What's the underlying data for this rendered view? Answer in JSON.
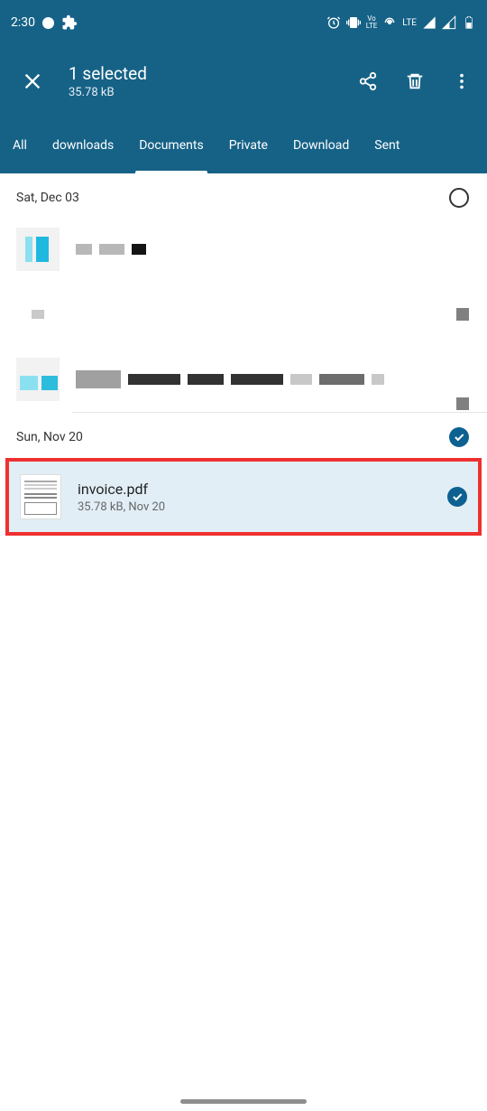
{
  "status": {
    "time": "2:30",
    "lte_label": "LTE",
    "volte_label": "Vo LTE"
  },
  "header": {
    "title": "1 selected",
    "subtitle": "35.78 kB"
  },
  "tabs": [
    {
      "label": "All",
      "active": false
    },
    {
      "label": "downloads",
      "active": false
    },
    {
      "label": "Documents",
      "active": true
    },
    {
      "label": "Private",
      "active": false
    },
    {
      "label": "Download",
      "active": false
    },
    {
      "label": "Sent",
      "active": false
    }
  ],
  "sections": [
    {
      "date": "Sat, Dec 03",
      "checked": false
    },
    {
      "date": "Sun, Nov 20",
      "checked": true
    }
  ],
  "selected_file": {
    "name": "invoice.pdf",
    "meta": "35.78 kB, Nov 20"
  }
}
